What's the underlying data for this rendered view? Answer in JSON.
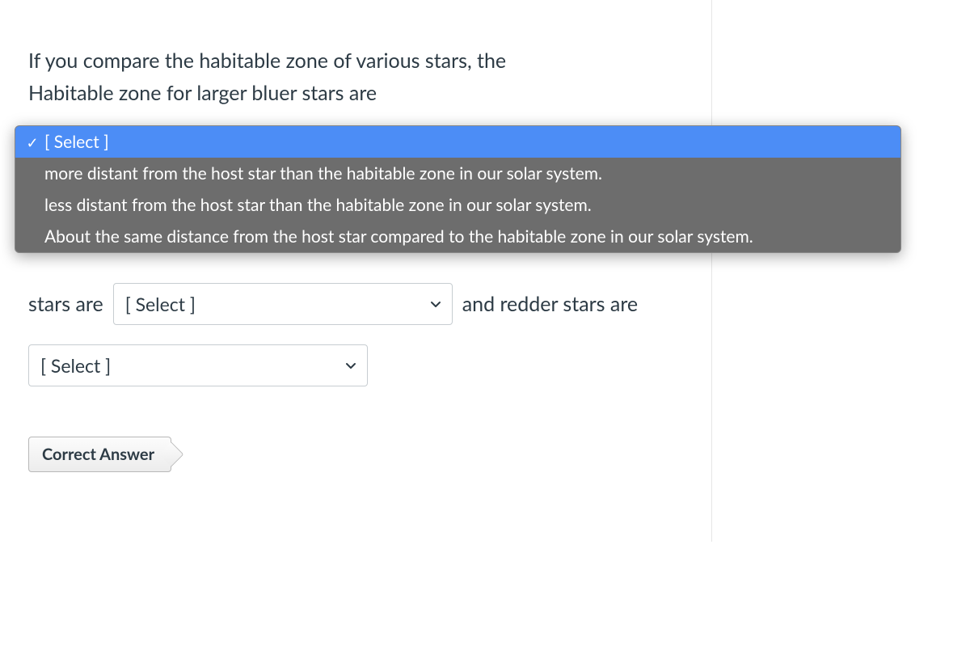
{
  "question": {
    "line1_prefix": "If you compare the habitable zone of various stars, the",
    "line2_prefix": "Habitable zone for larger bluer stars are",
    "mid_text": "stars are",
    "tail_text": "and redder stars are"
  },
  "dropdown_open": {
    "selected_label": "[ Select ]",
    "options": [
      "more distant from the host star than the habitable zone in our solar system.",
      "less distant from the host star than the habitable zone in our solar system.",
      "About the same distance from the host star compared to the habitable zone in our solar system."
    ]
  },
  "select2_placeholder": "[ Select ]",
  "select3_placeholder": "[ Select ]",
  "correct_answer_label": "Correct Answer"
}
